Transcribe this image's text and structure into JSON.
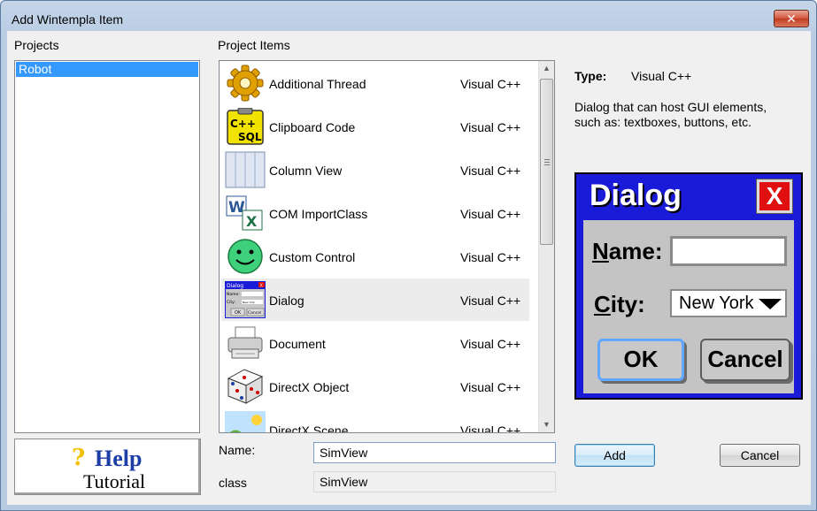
{
  "window": {
    "title": "Add Wintempla Item",
    "close_glyph": "✕"
  },
  "projects": {
    "label": "Projects",
    "items": [
      {
        "label": "Robot"
      }
    ]
  },
  "project_items": {
    "label": "Project Items",
    "items": [
      {
        "name": "Additional Thread",
        "type": "Visual C++",
        "icon": "gear-icon"
      },
      {
        "name": "Clipboard Code",
        "type": "Visual C++",
        "icon": "clipboard-cpp-sql-icon"
      },
      {
        "name": "Column View",
        "type": "Visual C++",
        "icon": "column-view-icon"
      },
      {
        "name": "COM ImportClass",
        "type": "Visual C++",
        "icon": "word-excel-icon"
      },
      {
        "name": "Custom Control",
        "type": "Visual C++",
        "icon": "smiley-icon"
      },
      {
        "name": "Dialog",
        "type": "Visual C++",
        "icon": "dialog-thumbnail-icon",
        "selected": true
      },
      {
        "name": "Document",
        "type": "Visual C++",
        "icon": "printer-icon"
      },
      {
        "name": "DirectX Object",
        "type": "Visual C++",
        "icon": "dice-icon"
      },
      {
        "name": "DirectX Scene",
        "type": "Visual C++",
        "icon": "scene-icon"
      }
    ],
    "clipboard_icon_text": [
      "C++",
      "SQL"
    ],
    "dialog_thumb": {
      "title": "Dialog",
      "close": "X",
      "name": "Name:",
      "city": "City:",
      "city_value": "New York",
      "ok": "OK",
      "cancel": "Cancel"
    }
  },
  "info": {
    "type_label": "Type:",
    "type_value": "Visual C++",
    "description": "Dialog that can host GUI elements, such as: textboxes, buttons, etc."
  },
  "preview": {
    "title": "Dialog",
    "close": "X",
    "name_label_first": "N",
    "name_label_rest": "ame:",
    "city_label_first": "C",
    "city_label_rest": "ity:",
    "city_value": "New York",
    "ok": "OK",
    "cancel": "Cancel"
  },
  "help": {
    "q": "?",
    "word": "Help",
    "tutorial": "Tutorial"
  },
  "form": {
    "name_label": "Name:",
    "name_value": "SimView",
    "class_label": "class",
    "class_value": "SimView"
  },
  "buttons": {
    "add": "Add",
    "cancel": "Cancel"
  },
  "colors": {
    "selection": "#3399ff",
    "preview_blue": "#1a1ad9",
    "close_red": "#e01010"
  }
}
